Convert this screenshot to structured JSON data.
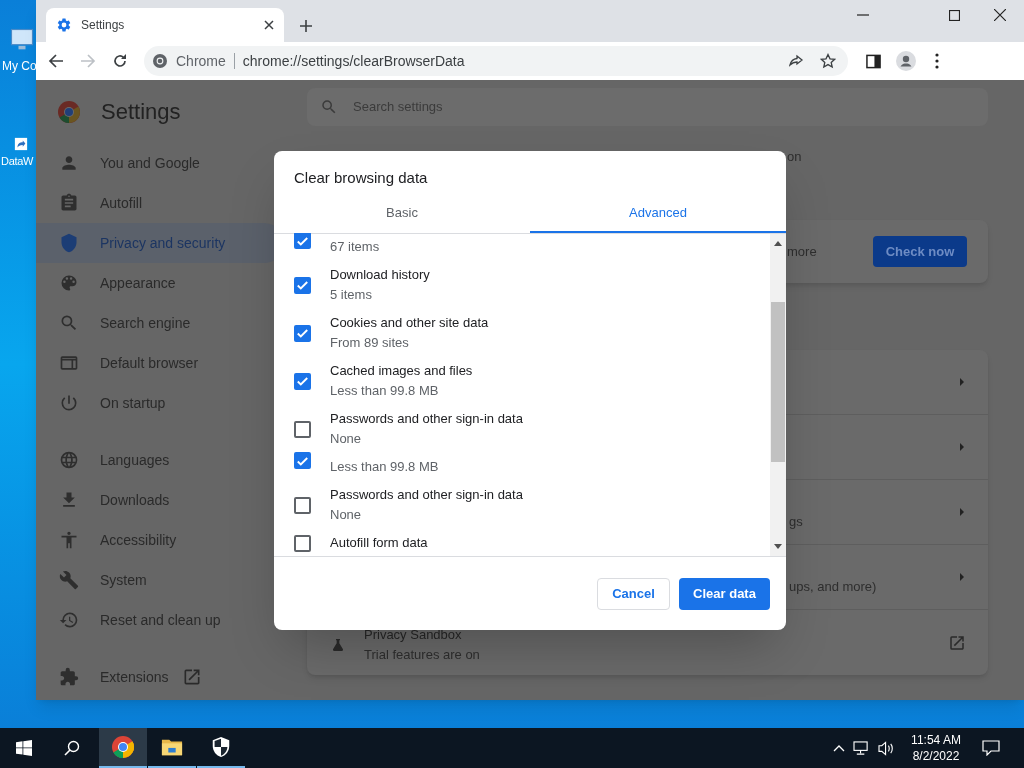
{
  "desktop": {
    "icons": [
      {
        "label": "My Co"
      },
      {
        "label": "DataW"
      }
    ]
  },
  "browser": {
    "tab": {
      "title": "Settings"
    },
    "address": {
      "site": "Chrome",
      "url": "chrome://settings/clearBrowserData"
    }
  },
  "settings": {
    "title": "Settings",
    "search": {
      "placeholder": "Search settings"
    },
    "nav_groups": [
      [
        {
          "label": "You and Google",
          "selected": false
        },
        {
          "label": "Autofill",
          "selected": false
        },
        {
          "label": "Privacy and security",
          "selected": true
        },
        {
          "label": "Appearance",
          "selected": false
        },
        {
          "label": "Search engine",
          "selected": false
        },
        {
          "label": "Default browser",
          "selected": false
        },
        {
          "label": "On startup",
          "selected": false
        }
      ],
      [
        {
          "label": "Languages",
          "selected": false
        },
        {
          "label": "Downloads",
          "selected": false
        },
        {
          "label": "Accessibility",
          "selected": false
        },
        {
          "label": "System",
          "selected": false
        },
        {
          "label": "Reset and clean up",
          "selected": false
        }
      ],
      [
        {
          "label": "Extensions",
          "selected": false
        }
      ]
    ],
    "fragments": {
      "top": "on",
      "safety": "more",
      "row_3": "gs",
      "row_4": "ups, and more)"
    },
    "check_button": "Check now",
    "privacy_sandbox": {
      "title": "Privacy Sandbox",
      "subtitle": "Trial features are on"
    }
  },
  "dialog": {
    "title": "Clear browsing data",
    "tabs": [
      {
        "label": "Basic",
        "selected": false
      },
      {
        "label": "Advanced",
        "selected": true
      }
    ],
    "items": [
      {
        "detail": "67 items",
        "checked": true
      },
      {
        "title": "Download history",
        "detail": "5 items",
        "checked": true
      },
      {
        "title": "Cookies and other site data",
        "detail": "From 89 sites",
        "checked": true
      },
      {
        "title": "Cached images and files",
        "detail": "Less than 99.8 MB",
        "checked": true
      },
      {
        "title": "Passwords and other sign-in data",
        "detail": "None",
        "checked": false
      },
      {
        "detail": "Less than 99.8 MB",
        "checked": true
      },
      {
        "title": "Passwords and other sign-in data",
        "detail": "None",
        "checked": false
      },
      {
        "title": "Autofill form data",
        "checked": false
      }
    ],
    "cancel": "Cancel",
    "confirm": "Clear data"
  },
  "taskbar": {
    "apps": [
      {
        "selected": true
      },
      {
        "selected": false
      },
      {
        "selected": false
      }
    ],
    "time": "11:54 AM",
    "date": "8/2/2022"
  }
}
